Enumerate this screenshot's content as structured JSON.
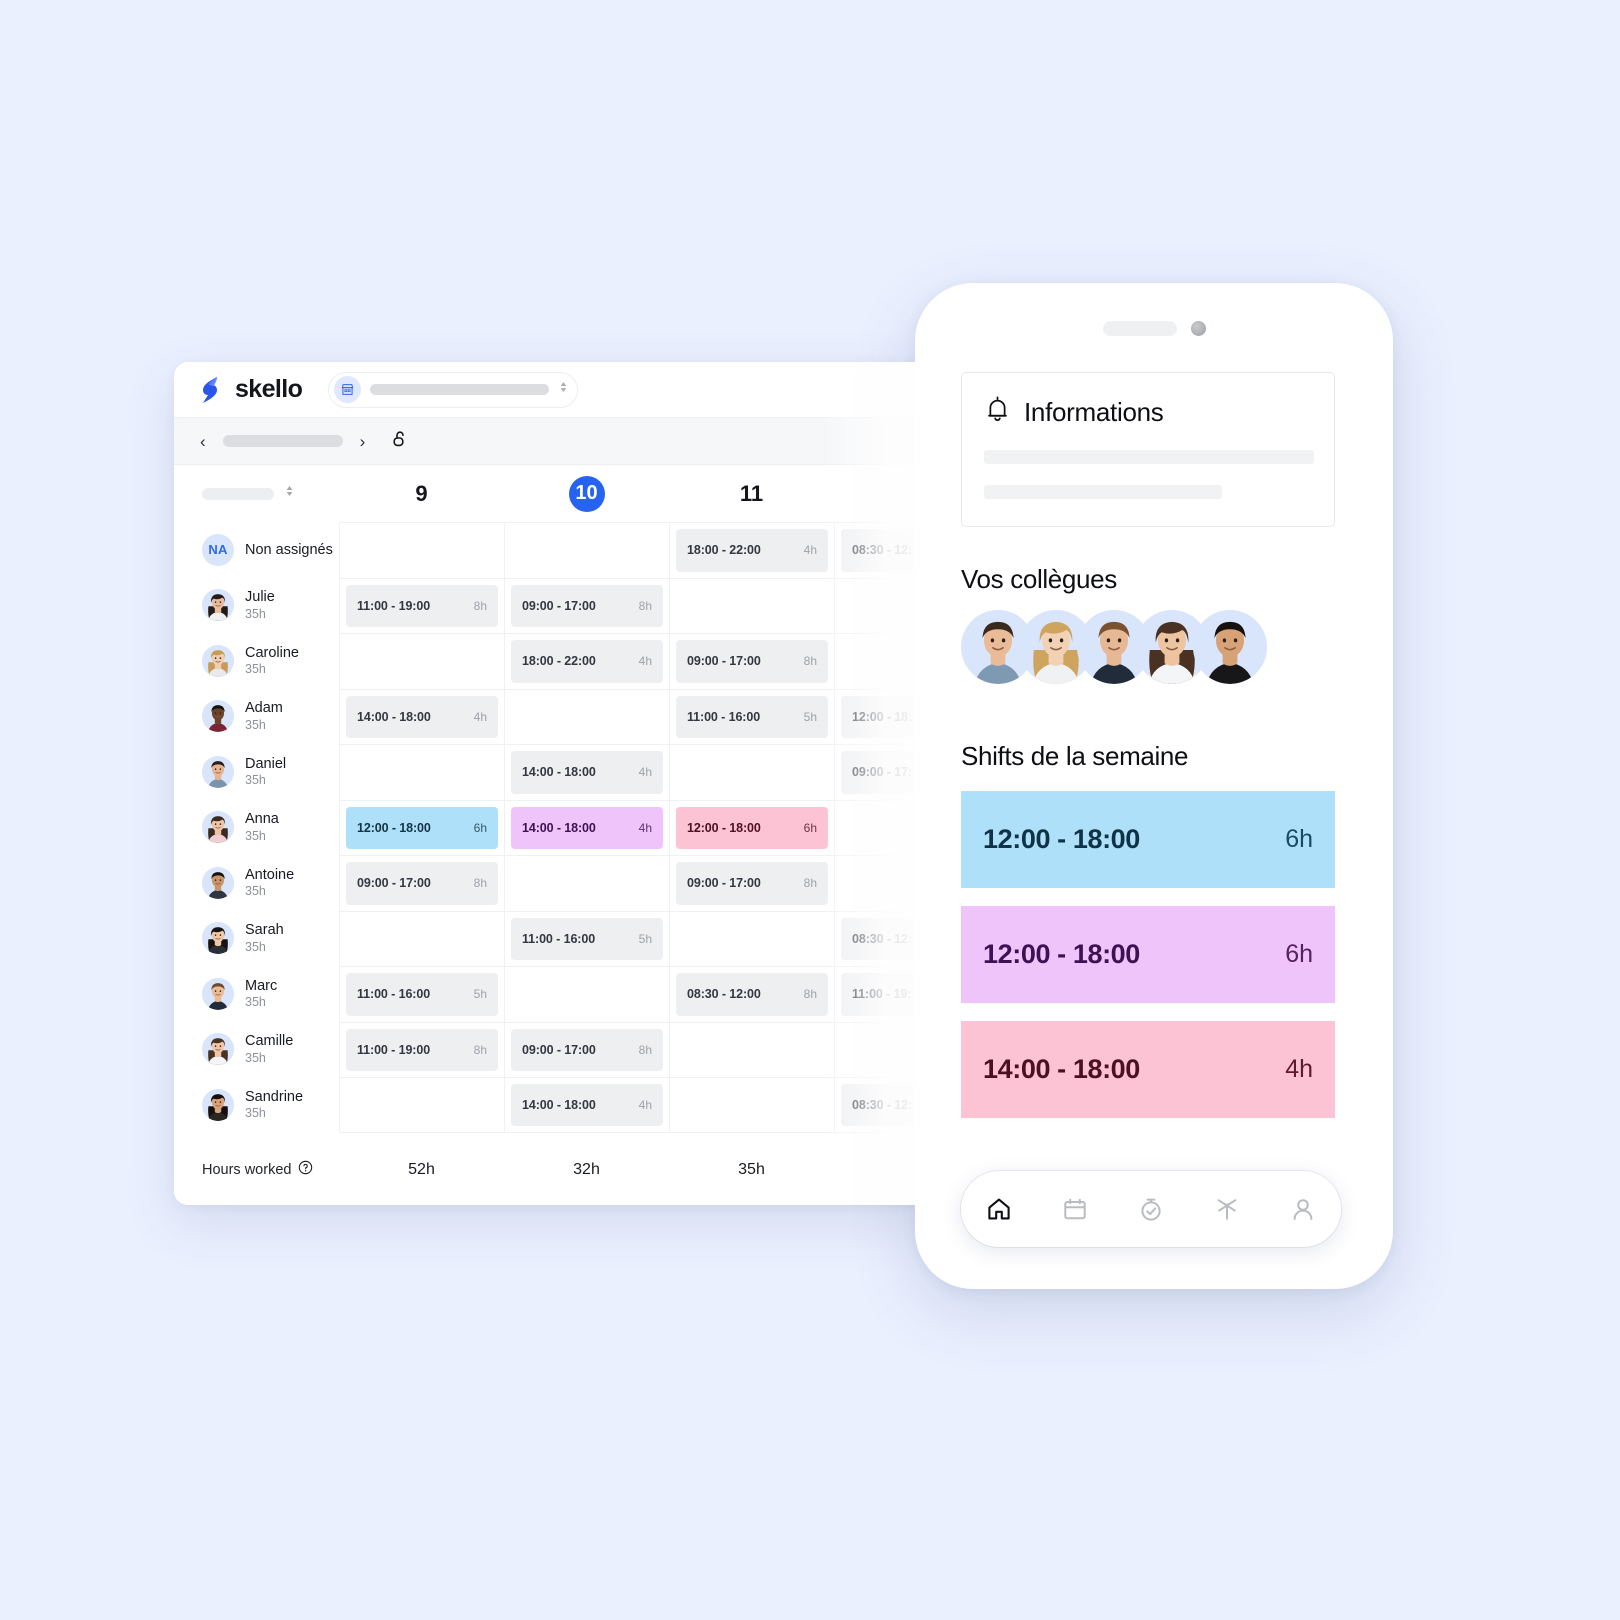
{
  "desktop": {
    "brand": "skello",
    "shop_selector": {
      "icon": "shop-icon",
      "value": ""
    },
    "nav": {
      "prev": "‹",
      "next": "›",
      "lock_icon": "unlock-icon"
    },
    "day_headers": [
      "9",
      "10",
      "11",
      ""
    ],
    "today_index": 1,
    "rows": [
      {
        "name": "Non assignés",
        "hours": "",
        "avatar": "NA",
        "cells": [
          {
            "time": "",
            "dur": "",
            "tone": "empty"
          },
          {
            "time": "",
            "dur": "",
            "tone": "empty"
          },
          {
            "time": "18:00 - 22:00",
            "dur": "4h",
            "tone": "grey"
          },
          {
            "time": "08:30 - 12:",
            "dur": "",
            "tone": "grey"
          }
        ]
      },
      {
        "name": "Julie",
        "hours": "35h",
        "avatar": "julie",
        "cells": [
          {
            "time": "11:00 - 19:00",
            "dur": "8h",
            "tone": "grey"
          },
          {
            "time": "09:00 - 17:00",
            "dur": "8h",
            "tone": "grey"
          },
          {
            "time": "",
            "dur": "",
            "tone": "empty"
          },
          {
            "time": "",
            "dur": "",
            "tone": "empty"
          }
        ]
      },
      {
        "name": "Caroline",
        "hours": "35h",
        "avatar": "caroline",
        "cells": [
          {
            "time": "",
            "dur": "",
            "tone": "empty"
          },
          {
            "time": "18:00 - 22:00",
            "dur": "4h",
            "tone": "grey"
          },
          {
            "time": "09:00 - 17:00",
            "dur": "8h",
            "tone": "grey"
          },
          {
            "time": "",
            "dur": "",
            "tone": "empty"
          }
        ]
      },
      {
        "name": "Adam",
        "hours": "35h",
        "avatar": "adam",
        "cells": [
          {
            "time": "14:00 - 18:00",
            "dur": "4h",
            "tone": "grey"
          },
          {
            "time": "",
            "dur": "",
            "tone": "empty"
          },
          {
            "time": "11:00 - 16:00",
            "dur": "5h",
            "tone": "grey"
          },
          {
            "time": "12:00 - 18:",
            "dur": "",
            "tone": "grey"
          }
        ]
      },
      {
        "name": "Daniel",
        "hours": "35h",
        "avatar": "daniel",
        "cells": [
          {
            "time": "",
            "dur": "",
            "tone": "empty"
          },
          {
            "time": "14:00 - 18:00",
            "dur": "4h",
            "tone": "grey"
          },
          {
            "time": "",
            "dur": "",
            "tone": "empty"
          },
          {
            "time": "09:00 - 17:",
            "dur": "",
            "tone": "grey"
          }
        ]
      },
      {
        "name": "Anna",
        "hours": "35h",
        "avatar": "anna",
        "cells": [
          {
            "time": "12:00 - 18:00",
            "dur": "6h",
            "tone": "blue"
          },
          {
            "time": "14:00 - 18:00",
            "dur": "4h",
            "tone": "purple"
          },
          {
            "time": "12:00 - 18:00",
            "dur": "6h",
            "tone": "pink"
          },
          {
            "time": "",
            "dur": "",
            "tone": "empty"
          }
        ]
      },
      {
        "name": "Antoine",
        "hours": "35h",
        "avatar": "antoine",
        "cells": [
          {
            "time": "09:00 - 17:00",
            "dur": "8h",
            "tone": "grey"
          },
          {
            "time": "",
            "dur": "",
            "tone": "empty"
          },
          {
            "time": "09:00 - 17:00",
            "dur": "8h",
            "tone": "grey"
          },
          {
            "time": "",
            "dur": "",
            "tone": "empty"
          }
        ]
      },
      {
        "name": "Sarah",
        "hours": "35h",
        "avatar": "sarah",
        "cells": [
          {
            "time": "",
            "dur": "",
            "tone": "empty"
          },
          {
            "time": "11:00 - 16:00",
            "dur": "5h",
            "tone": "grey"
          },
          {
            "time": "",
            "dur": "",
            "tone": "empty"
          },
          {
            "time": "08:30 - 12:",
            "dur": "",
            "tone": "grey"
          }
        ]
      },
      {
        "name": "Marc",
        "hours": "35h",
        "avatar": "marc",
        "cells": [
          {
            "time": "11:00 - 16:00",
            "dur": "5h",
            "tone": "grey"
          },
          {
            "time": "",
            "dur": "",
            "tone": "empty"
          },
          {
            "time": "08:30 - 12:00",
            "dur": "8h",
            "tone": "grey"
          },
          {
            "time": "11:00 - 19:",
            "dur": "",
            "tone": "grey"
          }
        ]
      },
      {
        "name": "Camille",
        "hours": "35h",
        "avatar": "camille",
        "cells": [
          {
            "time": "11:00 - 19:00",
            "dur": "8h",
            "tone": "grey"
          },
          {
            "time": "09:00 - 17:00",
            "dur": "8h",
            "tone": "grey"
          },
          {
            "time": "",
            "dur": "",
            "tone": "empty"
          },
          {
            "time": "",
            "dur": "",
            "tone": "empty"
          }
        ]
      },
      {
        "name": "Sandrine",
        "hours": "35h",
        "avatar": "sandrine",
        "cells": [
          {
            "time": "",
            "dur": "",
            "tone": "empty"
          },
          {
            "time": "14:00 - 18:00",
            "dur": "4h",
            "tone": "grey"
          },
          {
            "time": "",
            "dur": "",
            "tone": "empty"
          },
          {
            "time": "08:30 - 12:",
            "dur": "",
            "tone": "grey"
          }
        ]
      }
    ],
    "footer": {
      "label": "Hours worked",
      "help_icon": "help-circle-icon",
      "totals": [
        "52h",
        "32h",
        "35h",
        ""
      ]
    }
  },
  "phone": {
    "info": {
      "icon": "bell-icon",
      "title": "Informations"
    },
    "colleagues_title": "Vos collègues",
    "colleagues": [
      "colleague-1",
      "colleague-2",
      "colleague-3",
      "colleague-4",
      "colleague-5"
    ],
    "shifts_title": "Shifts de la semaine",
    "shifts": [
      {
        "time": "12:00 - 18:00",
        "dur": "6h",
        "tone": "blue"
      },
      {
        "time": "12:00 - 18:00",
        "dur": "6h",
        "tone": "purple"
      },
      {
        "time": "14:00 - 18:00",
        "dur": "4h",
        "tone": "pink"
      }
    ],
    "tabs": [
      {
        "icon": "home-icon",
        "active": true
      },
      {
        "icon": "calendar-icon",
        "active": false
      },
      {
        "icon": "stopwatch-icon",
        "active": false
      },
      {
        "icon": "palm-tree-icon",
        "active": false
      },
      {
        "icon": "person-icon",
        "active": false
      }
    ]
  },
  "colors": {
    "background": "#eaf0fe",
    "accent": "#2563f0",
    "shift_blue": "#aee0fa",
    "shift_purple": "#eec4fb",
    "shift_pink": "#fcc3d4",
    "shift_grey": "#eeeff1"
  }
}
